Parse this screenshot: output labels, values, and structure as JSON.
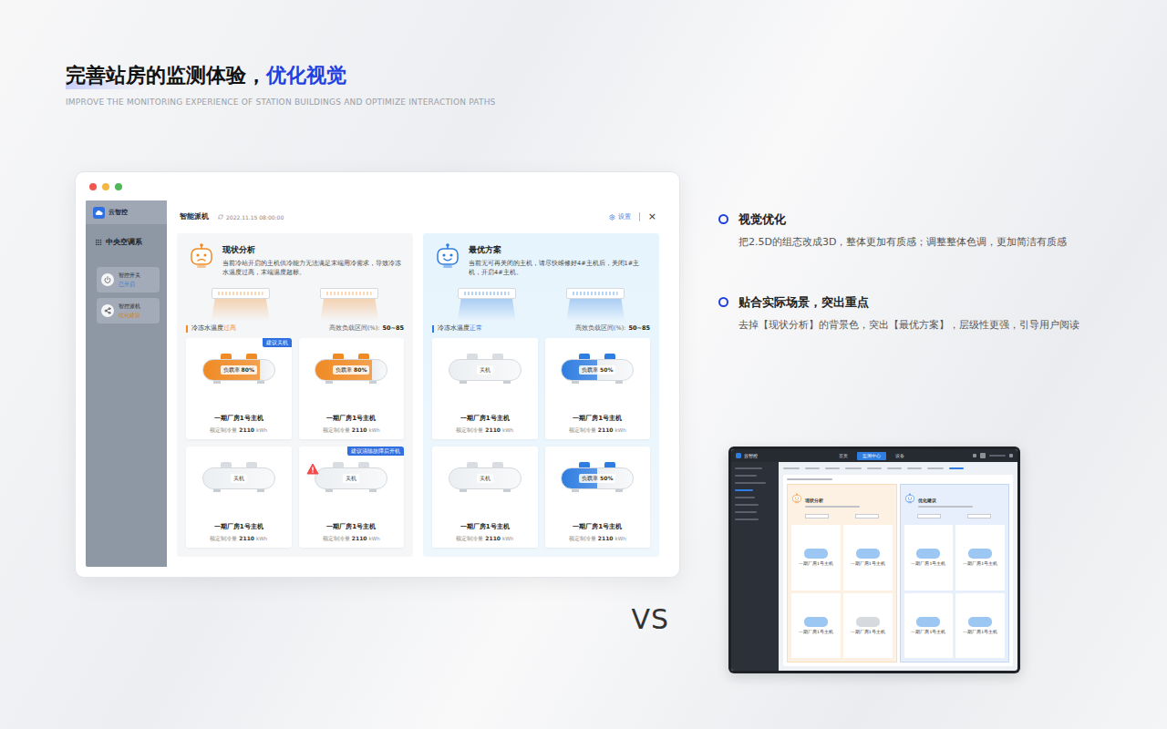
{
  "page": {
    "title": "完善站房的监测体验，",
    "title_highlight": "优化视觉",
    "subtitle": "IMPROVE THE MONITORING EXPERIENCE OF STATION BUILDINGS AND OPTIMIZE INTERACTION PATHS"
  },
  "mockup": {
    "app_name": "云智控",
    "section_title": "中央空调系",
    "sidebar": [
      {
        "label": "智控开关",
        "status": "已开启",
        "color": "#3a7bd5",
        "kind": "switch"
      },
      {
        "label": "智控派机",
        "status": "优化建议",
        "color": "#e07b1a",
        "kind": "dispatch"
      }
    ],
    "modal": {
      "title": "智能派机",
      "time": "2022.11.15 08:00:00",
      "settings": "设置",
      "close": "×"
    },
    "panels": [
      {
        "kind": "current",
        "highlighted": false,
        "color": "#f08a24",
        "title": "现状分析",
        "desc": "当前冷站开启的主机供冷能力无法满足末端用冷需求，导致冷冻水温度过高，末端温度超标。",
        "temp_label": "冷冻水温度",
        "temp_state": "过高",
        "range_label": "高效负载区间(%):",
        "range": "50~85",
        "chillers": [
          {
            "name": "一期厂房1号主机",
            "capacity_label": "额定制冷量",
            "capacity": "2110",
            "unit": "kWh",
            "running": true,
            "status_label": "负载率",
            "load": "80%",
            "level": 0.8,
            "badge": "建议关机",
            "warning": false
          },
          {
            "name": "一期厂房1号主机",
            "capacity_label": "额定制冷量",
            "capacity": "2110",
            "unit": "kWh",
            "running": true,
            "status_label": "负载率",
            "load": "80%",
            "level": 0.8,
            "badge": "",
            "warning": false
          },
          {
            "name": "一期厂房1号主机",
            "capacity_label": "额定制冷量",
            "capacity": "2110",
            "unit": "kWh",
            "running": false,
            "status_label": "关机",
            "load": "",
            "level": 0,
            "badge": "",
            "warning": false
          },
          {
            "name": "一期厂房1号主机",
            "capacity_label": "额定制冷量",
            "capacity": "2110",
            "unit": "kWh",
            "running": false,
            "status_label": "关机",
            "load": "",
            "level": 0,
            "badge": "建议清除故障后开机",
            "warning": true
          }
        ]
      },
      {
        "kind": "optimal",
        "highlighted": true,
        "color": "#2f7de1",
        "title": "最优方案",
        "desc": "当前无可再关闭的主机，请尽快维修好4#主机后，关闭1#主机，开启4#主机。",
        "temp_label": "冷冻水温度",
        "temp_state": "正常",
        "range_label": "高效负载区间(%):",
        "range": "50~85",
        "chillers": [
          {
            "name": "一期厂房1号主机",
            "capacity_label": "额定制冷量",
            "capacity": "2110",
            "unit": "kWh",
            "running": false,
            "status_label": "关机",
            "load": "",
            "level": 0,
            "badge": "",
            "warning": false
          },
          {
            "name": "一期厂房1号主机",
            "capacity_label": "额定制冷量",
            "capacity": "2110",
            "unit": "kWh",
            "running": true,
            "status_label": "负载率",
            "load": "50%",
            "level": 0.5,
            "badge": "",
            "warning": false
          },
          {
            "name": "一期厂房1号主机",
            "capacity_label": "额定制冷量",
            "capacity": "2110",
            "unit": "kWh",
            "running": false,
            "status_label": "关机",
            "load": "",
            "level": 0,
            "badge": "",
            "warning": false
          },
          {
            "name": "一期厂房1号主机",
            "capacity_label": "额定制冷量",
            "capacity": "2110",
            "unit": "kWh",
            "running": true,
            "status_label": "负载率",
            "load": "50%",
            "level": 0.5,
            "badge": "",
            "warning": false
          }
        ]
      }
    ]
  },
  "notes": [
    {
      "title": "视觉优化",
      "text": "把2.5D的组态改成3D，整体更加有质感；调整整体色调，更加简洁有质感"
    },
    {
      "title": "贴合实际场景，突出重点",
      "text": "去掉【现状分析】的背景色，突出【最优方案】，层级性更强，引导用户阅读"
    }
  ],
  "vs": "VS",
  "old_screenshot": {
    "app_name": "云智控",
    "nav": [
      {
        "label": "首页",
        "selected": false
      },
      {
        "label": "监测中心",
        "selected": true
      },
      {
        "label": "设备",
        "selected": false
      }
    ],
    "panels": [
      {
        "kind": "current",
        "title": "现状分析",
        "color": "#f08a24",
        "chillers": [
          {
            "name": "一期厂房1号主机",
            "running": true
          },
          {
            "name": "一期厂房1号主机",
            "running": true
          },
          {
            "name": "一期厂房1号主机",
            "running": true
          },
          {
            "name": "一期厂房1号主机",
            "running": false
          }
        ]
      },
      {
        "kind": "optimal",
        "title": "优化建议",
        "color": "#2f7de1",
        "chillers": [
          {
            "name": "一期厂房1号主机",
            "running": true
          },
          {
            "name": "一期厂房1号主机",
            "running": true
          },
          {
            "name": "一期厂房1号主机",
            "running": true
          },
          {
            "name": "一期厂房1号主机",
            "running": true
          }
        ]
      }
    ]
  }
}
